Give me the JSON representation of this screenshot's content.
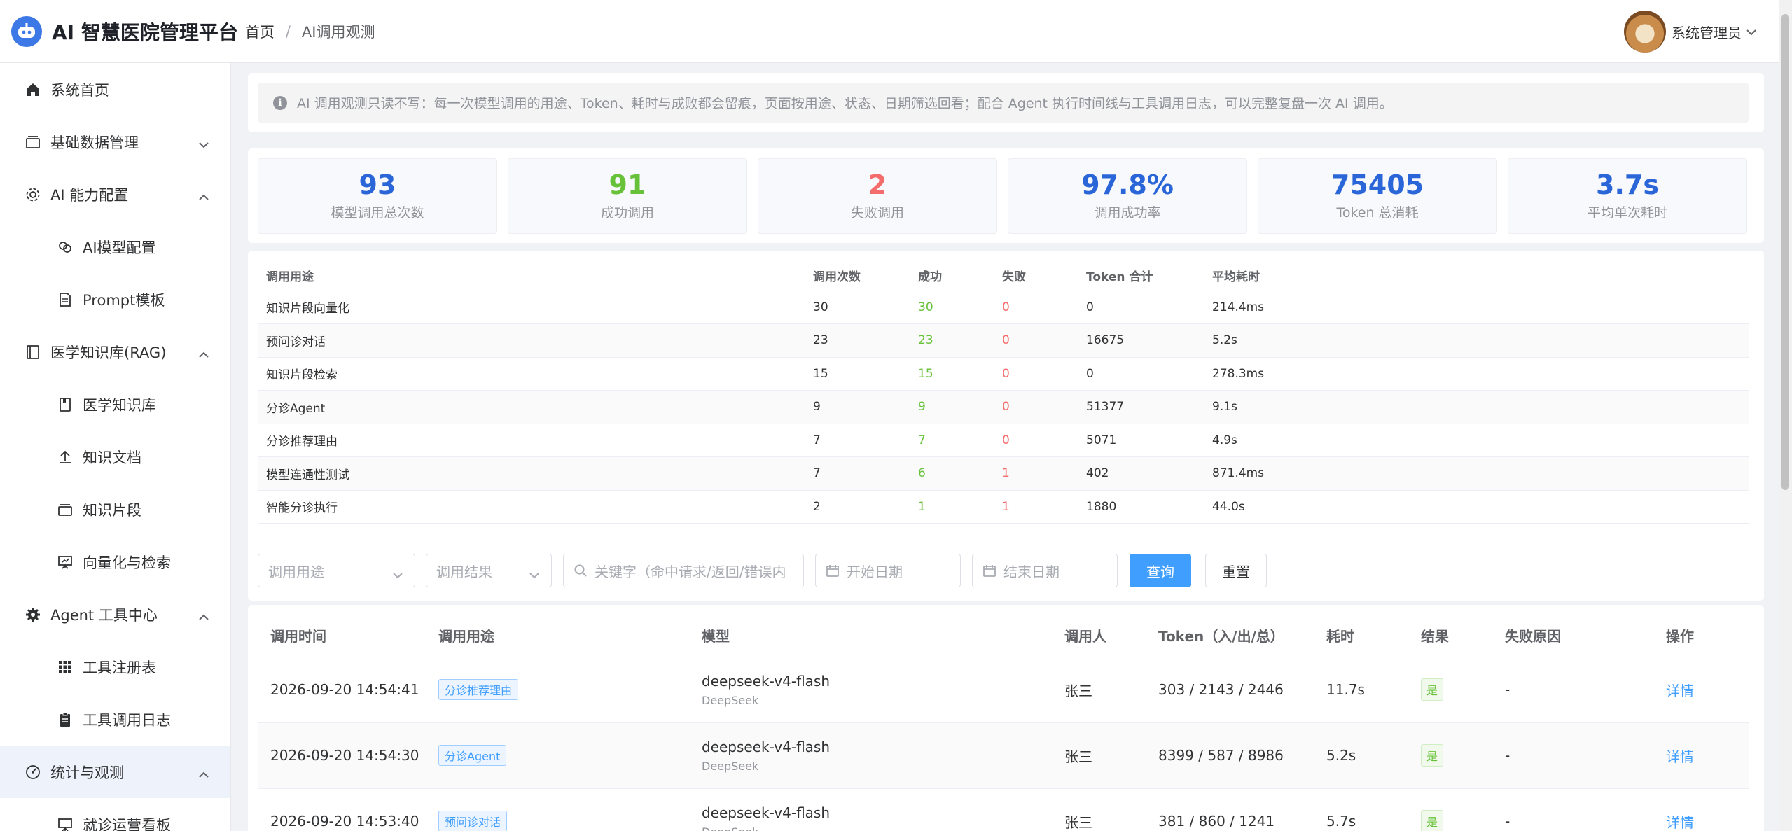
{
  "header": {
    "brand": "AI 智慧医院管理平台",
    "breadcrumb_home": "首页",
    "breadcrumb_sep": "/",
    "breadcrumb_current": "AI调用观测",
    "user_name": "系统管理员"
  },
  "sidebar": {
    "items": [
      {
        "label": "系统首页",
        "icon": "home-icon"
      },
      {
        "label": "基础数据管理",
        "icon": "database-icon",
        "arrow": "chevron-down"
      },
      {
        "label": "AI 能力配置",
        "icon": "gear-icon",
        "arrow": "chevron-up"
      },
      {
        "label": "AI模型配置",
        "icon": "model-icon",
        "sub": true
      },
      {
        "label": "Prompt模板",
        "icon": "document-icon",
        "sub": true
      },
      {
        "label": "医学知识库(RAG)",
        "icon": "book-icon",
        "arrow": "chevron-up"
      },
      {
        "label": "医学知识库",
        "icon": "notebook-icon",
        "sub": true
      },
      {
        "label": "知识文档",
        "icon": "upload-icon",
        "sub": true
      },
      {
        "label": "知识片段",
        "icon": "layers-icon",
        "sub": true
      },
      {
        "label": "向量化与检索",
        "icon": "presentation-icon",
        "sub": true
      },
      {
        "label": "Agent 工具中心",
        "icon": "cog-icon",
        "arrow": "chevron-up"
      },
      {
        "label": "工具注册表",
        "icon": "grid-icon",
        "sub": true
      },
      {
        "label": "工具调用日志",
        "icon": "clipboard-icon",
        "sub": true
      },
      {
        "label": "统计与观测",
        "icon": "gauge-icon",
        "arrow": "chevron-up",
        "active": true
      },
      {
        "label": "就诊运营看板",
        "icon": "board-icon",
        "sub": true
      }
    ]
  },
  "notice": "AI 调用观测只读不写：每一次模型调用的用途、Token、耗时与成败都会留痕，页面按用途、状态、日期筛选回看；配合 Agent 执行时间线与工具调用日志，可以完整复盘一次 AI 调用。",
  "stats": [
    {
      "value": "93",
      "label": "模型调用总次数",
      "color": "#2a66d8"
    },
    {
      "value": "91",
      "label": "成功调用",
      "color": "#67c23a"
    },
    {
      "value": "2",
      "label": "失败调用",
      "color": "#f56c6c"
    },
    {
      "value": "97.8%",
      "label": "调用成功率",
      "color": "#2a66d8"
    },
    {
      "value": "75405",
      "label": "Token 总消耗",
      "color": "#2a66d8"
    },
    {
      "value": "3.7s",
      "label": "平均单次耗时",
      "color": "#2a66d8"
    }
  ],
  "summary": {
    "headers": [
      "调用用途",
      "调用次数",
      "成功",
      "失败",
      "Token 合计",
      "平均耗时"
    ],
    "rows": [
      [
        "知识片段向量化",
        "30",
        "30",
        "0",
        "0",
        "214.4ms"
      ],
      [
        "预问诊对话",
        "23",
        "23",
        "0",
        "16675",
        "5.2s"
      ],
      [
        "知识片段检索",
        "15",
        "15",
        "0",
        "0",
        "278.3ms"
      ],
      [
        "分诊Agent",
        "9",
        "9",
        "0",
        "51377",
        "9.1s"
      ],
      [
        "分诊推荐理由",
        "7",
        "7",
        "0",
        "5071",
        "4.9s"
      ],
      [
        "模型连通性测试",
        "7",
        "6",
        "1",
        "402",
        "871.4ms"
      ],
      [
        "智能分诊执行",
        "2",
        "1",
        "1",
        "1880",
        "44.0s"
      ]
    ]
  },
  "filters": {
    "purpose_placeholder": "调用用途",
    "result_placeholder": "调用结果",
    "keyword_placeholder": "关键字（命中请求/返回/错误内",
    "start_placeholder": "开始日期",
    "end_placeholder": "结束日期",
    "query_label": "查询",
    "reset_label": "重置"
  },
  "logs": {
    "headers": [
      "调用时间",
      "调用用途",
      "模型",
      "调用人",
      "Token（入/出/总）",
      "耗时",
      "结果",
      "失败原因",
      "操作"
    ],
    "rows": [
      {
        "time": "2026-09-20 14:54:41",
        "purpose": "分诊推荐理由",
        "model": "deepseek-v4-flash",
        "vendor": "DeepSeek",
        "user": "张三",
        "tokens": "303 / 2143 / 2446",
        "duration": "11.7s",
        "result": "是",
        "reason": "-",
        "action": "详情"
      },
      {
        "time": "2026-09-20 14:54:30",
        "purpose": "分诊Agent",
        "model": "deepseek-v4-flash",
        "vendor": "DeepSeek",
        "user": "张三",
        "tokens": "8399 / 587 / 8986",
        "duration": "5.2s",
        "result": "是",
        "reason": "-",
        "action": "详情"
      },
      {
        "time": "2026-09-20 14:53:40",
        "purpose": "预问诊对话",
        "model": "deepseek-v4-flash",
        "vendor": "DeepSeek",
        "user": "张三",
        "tokens": "381 / 860 / 1241",
        "duration": "5.7s",
        "result": "是",
        "reason": "-",
        "action": "详情"
      }
    ]
  }
}
